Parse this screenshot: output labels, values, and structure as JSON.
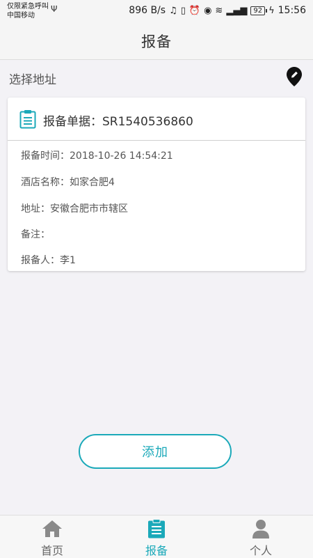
{
  "status_bar": {
    "carrier_line1": "仅限紧急呼叫",
    "carrier_line2": "中国移动",
    "net_speed": "896 B/s",
    "battery": "92",
    "time": "15:56"
  },
  "nav": {
    "title": "报备"
  },
  "address": {
    "label": "选择地址"
  },
  "card": {
    "title": "报备单据：SR1540536860",
    "rows": [
      "报备时间：2018-10-26 14:54:21",
      "酒店名称：如家合肥4",
      "地址：安徽合肥市市辖区",
      "备注：",
      "报备人：李1"
    ]
  },
  "actions": {
    "add_label": "添加"
  },
  "tabs": [
    {
      "label": "首页",
      "icon": "home-icon",
      "active": false
    },
    {
      "label": "报备",
      "icon": "clipboard-icon",
      "active": true
    },
    {
      "label": "个人",
      "icon": "person-icon",
      "active": false
    }
  ],
  "colors": {
    "accent": "#1ba9b9",
    "background": "#f3f2f6",
    "tab_inactive": "#8a8a8a"
  }
}
